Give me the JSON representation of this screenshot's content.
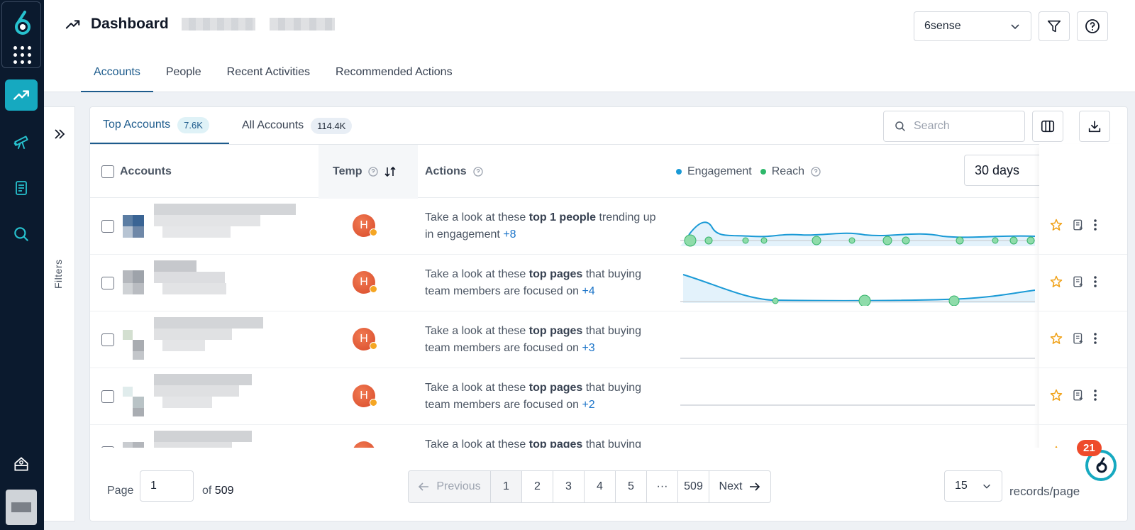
{
  "header": {
    "title": "Dashboard",
    "org_select": "6sense",
    "tabs": [
      "Accounts",
      "People",
      "Recent Activities",
      "Recommended Actions"
    ]
  },
  "filters": {
    "label": "Filters"
  },
  "sub_tabs": [
    {
      "label": "Top Accounts",
      "count": "7.6K"
    },
    {
      "label": "All Accounts",
      "count": "114.4K"
    }
  ],
  "search": {
    "placeholder": "Search"
  },
  "table": {
    "columns": {
      "accounts": "Accounts",
      "temp": "Temp",
      "actions": "Actions"
    },
    "legend": {
      "engagement": "Engagement",
      "reach": "Reach"
    },
    "range": "30 days",
    "rows": [
      {
        "temp": "H",
        "pre": "Take a look at these ",
        "bold": "top 1 people",
        "post": " trending up in engagement ",
        "more": "+8"
      },
      {
        "temp": "H",
        "pre": "Take a look at these ",
        "bold": "top pages",
        "post": " that buying team members are focused on ",
        "more": "+4"
      },
      {
        "temp": "H",
        "pre": "Take a look at these ",
        "bold": "top pages",
        "post": " that buying team members are focused on ",
        "more": "+3"
      },
      {
        "temp": "H",
        "pre": "Take a look at these ",
        "bold": "top pages",
        "post": " that buying team members are focused on ",
        "more": "+2"
      },
      {
        "temp": "H",
        "pre": "Take a look at these ",
        "bold": "top pages",
        "post": " that buying",
        "more": ""
      }
    ]
  },
  "pager": {
    "page_label": "Page",
    "page_value": "1",
    "of_label": "of",
    "total": "509",
    "prev": "Previous",
    "next": "Next",
    "pages": [
      "1",
      "2",
      "3",
      "4",
      "5",
      "···",
      "509"
    ],
    "per_page": "15",
    "per_page_label": "records/page"
  },
  "notification": {
    "count": "21"
  },
  "colors": {
    "accent": "#1d5b8c",
    "rail": "#0b1a2e",
    "active_nav": "#16a9c0",
    "engagement": "#1a9ad6",
    "reach": "#2db86a",
    "hot": "#e0502e"
  }
}
